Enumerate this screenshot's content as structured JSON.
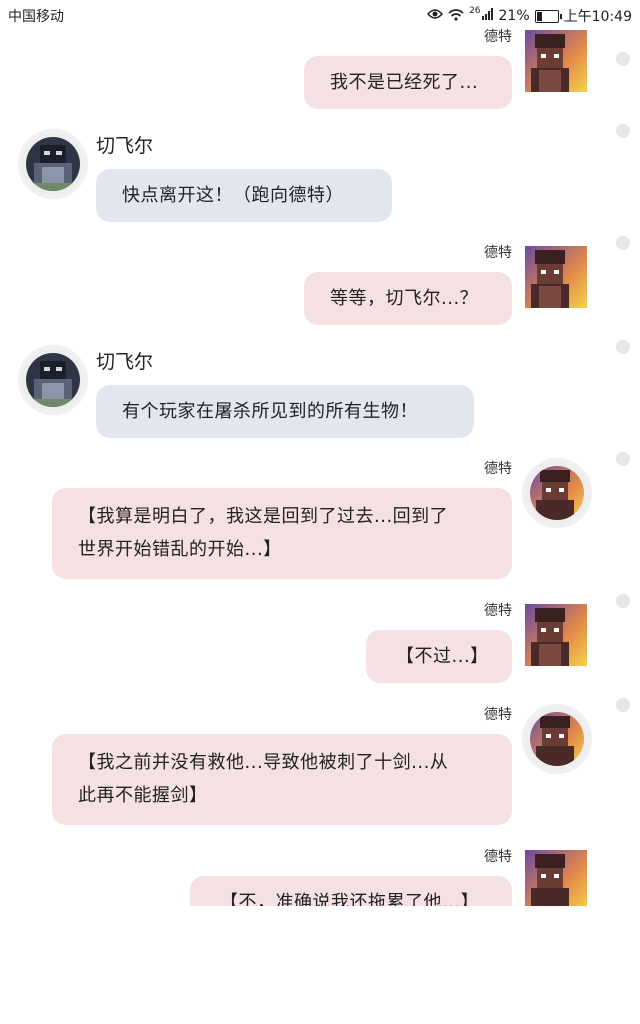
{
  "status_bar": {
    "carrier": "中国移动",
    "network": "26",
    "battery": "21%",
    "time": "上午10:49"
  },
  "icons": {
    "eye": "eye-icon",
    "wifi": "wifi-icon",
    "signal": "signal-icon",
    "battery": "battery-icon"
  },
  "colors": {
    "right_bubble": "#f5e0e2",
    "left_bubble": "#e2e7ef"
  },
  "messages": [
    {
      "side": "right",
      "sender": "德特",
      "text": "我不是已经死了..."
    },
    {
      "side": "left",
      "sender": "切飞尔",
      "text": "快点离开这！（跑向德特）"
    },
    {
      "side": "right",
      "sender": "德特",
      "text": "等等，切飞尔...？"
    },
    {
      "side": "left",
      "sender": "切飞尔",
      "text": "有个玩家在屠杀所见到的所有生物！"
    },
    {
      "side": "right",
      "sender": "德特",
      "line1": "【我算是明白了，我这是回到了过去...回到了",
      "line2": "世界开始错乱的开始...】"
    },
    {
      "side": "right",
      "sender": "德特",
      "text": "【不过...】"
    },
    {
      "side": "right",
      "sender": "德特",
      "line1": "【我之前并没有救他...导致他被刺了十剑...从",
      "line2": "此再不能握剑】"
    },
    {
      "side": "right",
      "sender": "德特",
      "text": "【不，准确说我还拖累了他...】"
    }
  ]
}
